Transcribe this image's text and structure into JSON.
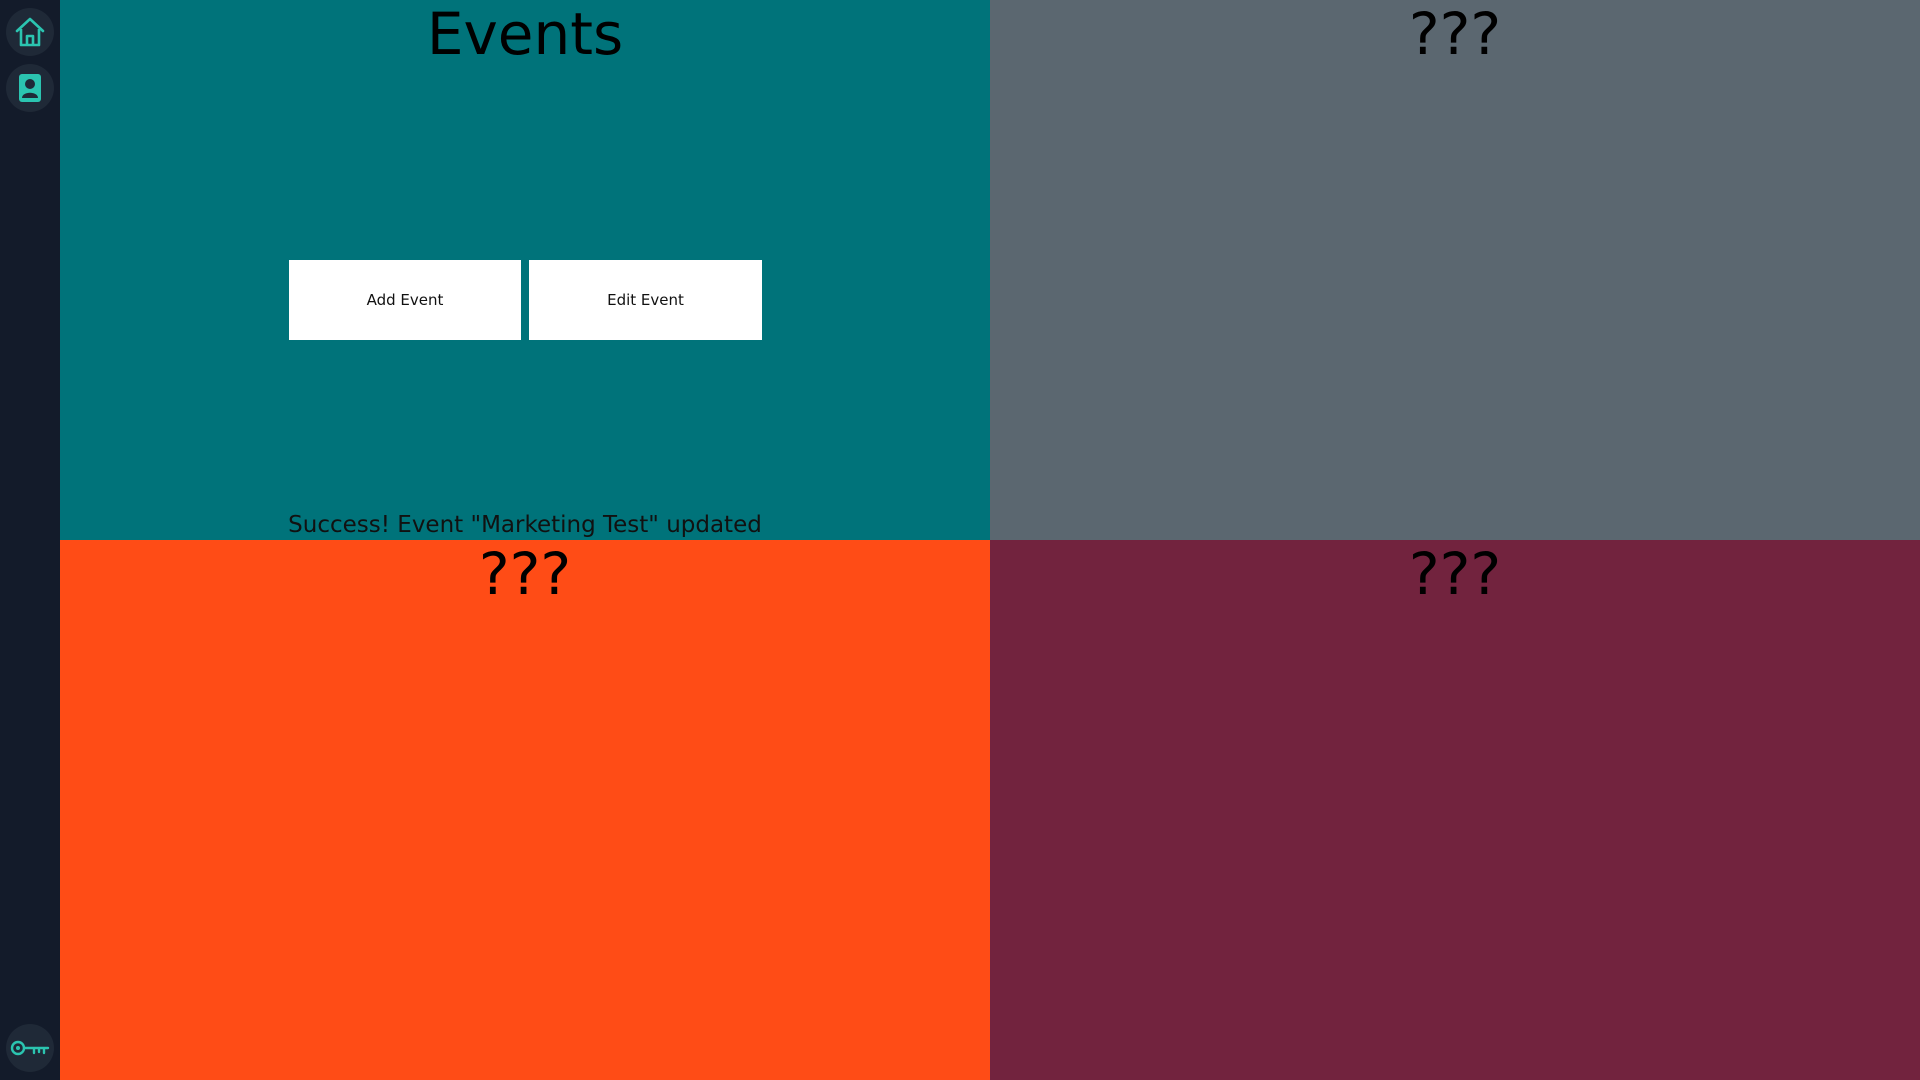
{
  "sidebar": {
    "items": [
      {
        "icon": "home-icon"
      },
      {
        "icon": "user-contact-icon"
      }
    ],
    "footer_icon": "key-icon",
    "accent_color": "#2bc4b0"
  },
  "panels": {
    "events": {
      "title": "Events",
      "add_button": "Add Event",
      "edit_button": "Edit Event",
      "status": "Success! Event \"Marketing Test\" updated",
      "color": "#00737a"
    },
    "top_right": {
      "title": "???",
      "color": "#5b6770"
    },
    "bottom_left": {
      "title": "???",
      "color": "#ff4c16"
    },
    "bottom_right": {
      "title": "???",
      "color": "#72233e"
    }
  }
}
